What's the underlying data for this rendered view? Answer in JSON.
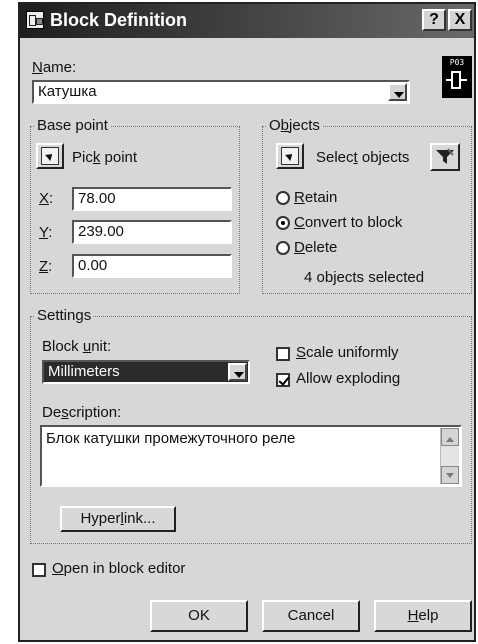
{
  "window": {
    "title": "Block Definition"
  },
  "titlebar": {
    "help_label": "?",
    "close_label": "X"
  },
  "name": {
    "label_ul": "N",
    "label_rest": "ame:",
    "value": "Катушка",
    "preview_tag": "P03"
  },
  "base_point": {
    "group_label": "Base point",
    "pick_ul": "Pic",
    "pick_k": "k",
    "pick_rest": " point",
    "x_label": "X",
    "x_value": "78.00",
    "y_label": "Y",
    "y_value": "239.00",
    "z_label": "Z",
    "z_value": "0.00"
  },
  "objects": {
    "group_label_a": "O",
    "group_label_b": "b",
    "group_label_c": "jects",
    "select_a": "Selec",
    "select_b": "t",
    "select_c": " objects",
    "retain_ul": "R",
    "retain_rest": "etain",
    "convert_ul": "C",
    "convert_rest": "onvert to block",
    "delete_ul": "D",
    "delete_rest": "elete",
    "count_text": "4 objects selected"
  },
  "settings": {
    "group_label": "Settings",
    "unit_a": "Block ",
    "unit_b": "u",
    "unit_c": "nit:",
    "unit_value": "Millimeters",
    "scale_ul": "S",
    "scale_rest": "cale uniformly",
    "explode_text": "Allow exploding",
    "desc_a": "De",
    "desc_b": "s",
    "desc_c": "cription:",
    "description": "Блок катушки промежуточного реле",
    "hyper_a": "Hyper",
    "hyper_b": "l",
    "hyper_c": "ink..."
  },
  "open_editor": {
    "ul": "O",
    "rest": "pen in block editor"
  },
  "buttons": {
    "ok": "OK",
    "cancel": "Cancel",
    "help_ul": "H",
    "help_rest": "elp"
  }
}
